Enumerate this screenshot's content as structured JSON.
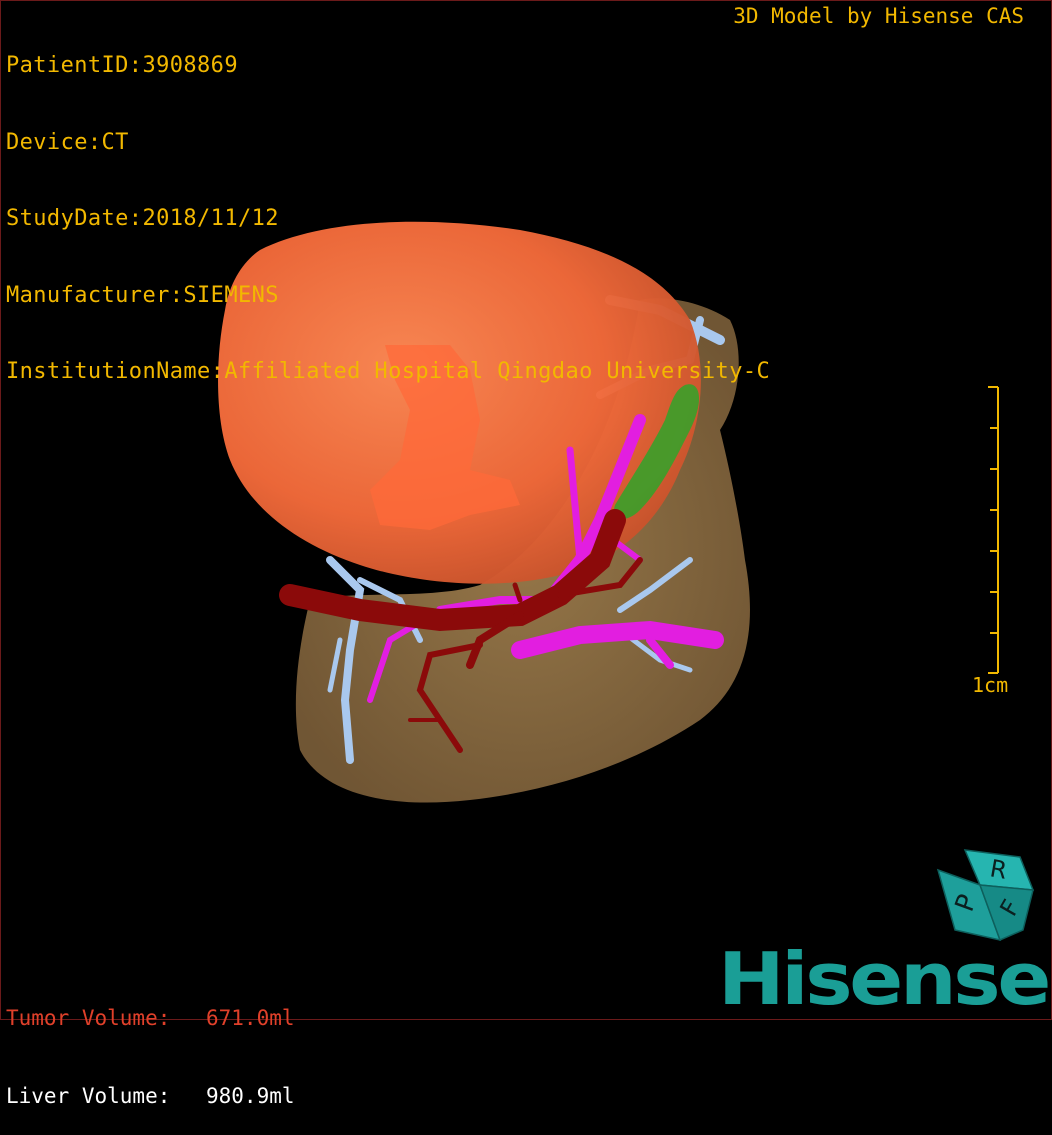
{
  "header": {
    "patient_id": "PatientID:3908869",
    "device": "Device:CT",
    "study_date": "StudyDate:2018/11/12",
    "manufacturer": "Manufacturer:SIEMENS",
    "institution": "InstitutionName:Affiliated Hospital Qingdao University-C",
    "credit": "3D Model by Hisense CAS"
  },
  "volumes": {
    "tumor_label": "Tumor Volume:",
    "tumor_value": "671.0ml",
    "liver_label": "Liver Volume:",
    "liver_value": "980.9ml"
  },
  "scale": {
    "label": "1cm"
  },
  "orientation_cube": {
    "faces": [
      "P",
      "R",
      "F"
    ]
  },
  "logo": {
    "text": "Hisense"
  },
  "colors": {
    "overlay_text": "#f2b800",
    "tumor_text": "#e0402a",
    "liver_text": "#ffffff",
    "tumor": "#ff6a3a",
    "liver": "#8a6a3f",
    "artery": "#8b0a0a",
    "portal_vein": "#e21ee0",
    "hepatic_vein": "#a9c8ee",
    "gallbladder": "#3aa02a",
    "brand": "#1a9e96"
  },
  "model": {
    "structures": [
      "tumor",
      "liver",
      "hepatic-artery",
      "portal-vein",
      "hepatic-vein",
      "gallbladder"
    ]
  }
}
